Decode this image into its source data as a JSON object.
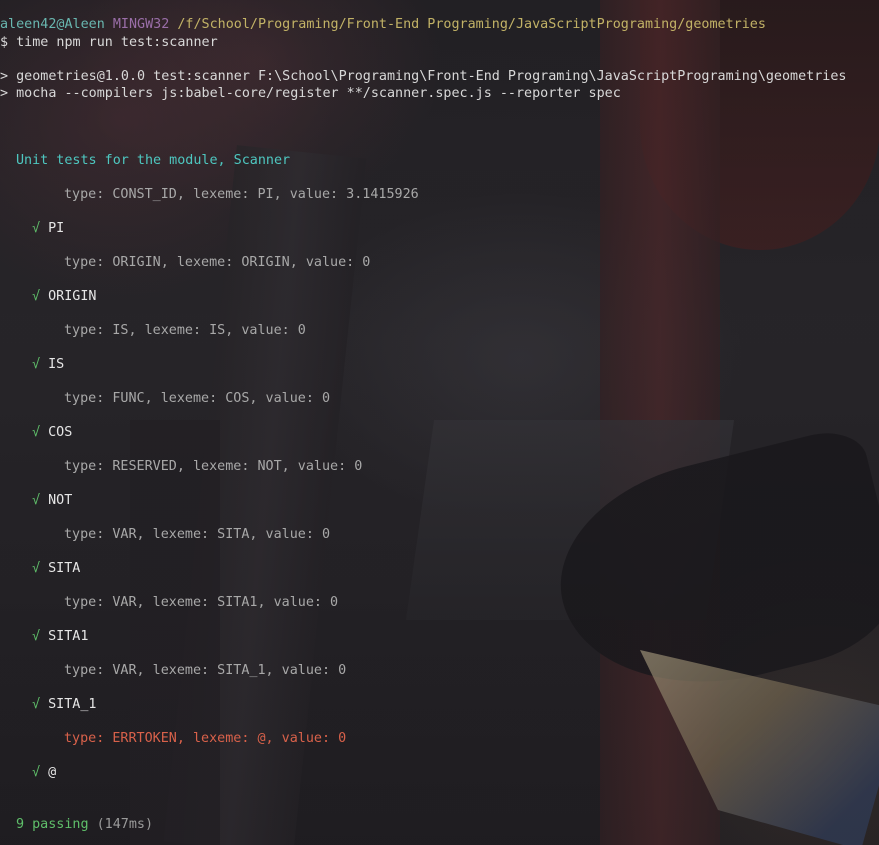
{
  "prompt": {
    "user_host": "aleen42@Aleen",
    "system": "MINGW32",
    "path": "/f/School/Programing/Front-End Programing/JavaScriptPrograming/geometries",
    "symbol": "$",
    "command": "time npm run test:scanner"
  },
  "npm_output": [
    "> geometries@1.0.0 test:scanner F:\\School\\Programing\\Front-End Programing\\JavaScriptPrograming\\geometries",
    "> mocha --compilers js:babel-core/register **/scanner.spec.js --reporter spec"
  ],
  "suite": {
    "title": "Unit tests for the module, Scanner",
    "check_mark": "√",
    "entries": [
      {
        "log": "type: CONST_ID, lexeme: PI, value: 3.1415926",
        "test": "PI",
        "error": false
      },
      {
        "log": "type: ORIGIN, lexeme: ORIGIN, value: 0",
        "test": "ORIGIN",
        "error": false
      },
      {
        "log": "type: IS, lexeme: IS, value: 0",
        "test": "IS",
        "error": false
      },
      {
        "log": "type: FUNC, lexeme: COS, value: 0",
        "test": "COS",
        "error": false
      },
      {
        "log": "type: RESERVED, lexeme: NOT, value: 0",
        "test": "NOT",
        "error": false
      },
      {
        "log": "type: VAR, lexeme: SITA, value: 0",
        "test": "SITA",
        "error": false
      },
      {
        "log": "type: VAR, lexeme: SITA1, value: 0",
        "test": "SITA1",
        "error": false
      },
      {
        "log": "type: VAR, lexeme: SITA_1, value: 0",
        "test": "SITA_1",
        "error": false
      },
      {
        "log": "type: ERRTOKEN, lexeme: @, value: 0",
        "test": "@",
        "error": true
      }
    ]
  },
  "summary": {
    "passing": "9 passing",
    "duration": "(147ms)"
  },
  "colors": {
    "prompt_user": "#69b7b0",
    "prompt_system": "#9a6ea8",
    "prompt_path": "#c2b266",
    "suite_title": "#4ec7c0",
    "check": "#5fbf6a",
    "error_log": "#d8614a"
  }
}
